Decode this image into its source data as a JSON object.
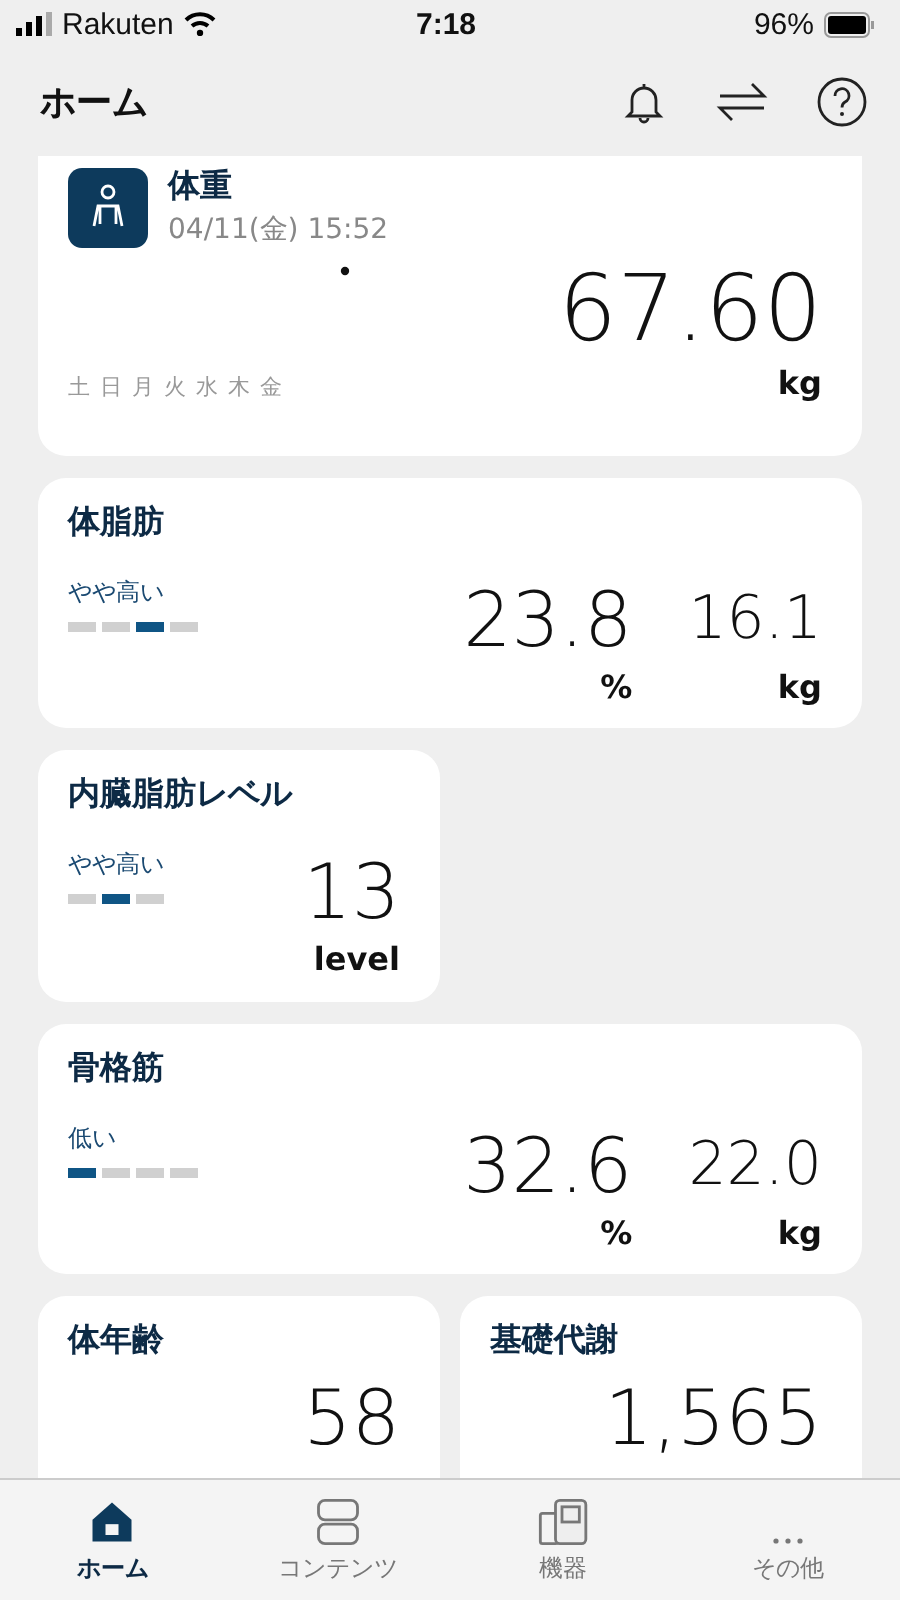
{
  "status_bar": {
    "carrier": "Rakuten",
    "time": "7:18",
    "battery": "96%"
  },
  "header": {
    "title": "ホーム"
  },
  "weight_card": {
    "title": "体重",
    "date": "04/11(金) 15:52",
    "value": "67.60",
    "unit": "kg",
    "days": [
      "土",
      "日",
      "月",
      "火",
      "水",
      "木",
      "金"
    ]
  },
  "metric_cards": [
    {
      "kind": "wide",
      "title": "体脂肪",
      "status": "やや高い",
      "segments": [
        {
          "selected": false
        },
        {
          "selected": false
        },
        {
          "selected": true
        },
        {
          "selected": false
        }
      ],
      "readings": [
        {
          "value": "23.8",
          "unit": "%"
        },
        {
          "value": "16.1",
          "unit": "kg"
        }
      ]
    },
    {
      "kind": "half",
      "title": "内臓脂肪レベル",
      "status": "やや高い",
      "segments": [
        {
          "selected": false
        },
        {
          "selected": true
        },
        {
          "selected": false
        }
      ],
      "readings": [
        {
          "value": "13",
          "unit": "level"
        }
      ]
    },
    {
      "kind": "wide",
      "title": "骨格筋",
      "status": "低い",
      "segments": [
        {
          "selected": true
        },
        {
          "selected": false
        },
        {
          "selected": false
        },
        {
          "selected": false
        }
      ],
      "readings": [
        {
          "value": "32.6",
          "unit": "%"
        },
        {
          "value": "22.0",
          "unit": "kg"
        }
      ]
    },
    {
      "kind": "half",
      "title": "体年齢",
      "readings": [
        {
          "value": "58"
        }
      ]
    },
    {
      "kind": "half",
      "title": "基礎代謝",
      "readings": [
        {
          "value": "1,565"
        }
      ]
    }
  ],
  "tab_bar": [
    {
      "kind": "home",
      "label": "ホーム",
      "selected": true
    },
    {
      "kind": "contents",
      "label": "コンテンツ",
      "selected": false
    },
    {
      "kind": "devices",
      "label": "機器",
      "selected": false
    },
    {
      "kind": "more",
      "label": "その他",
      "selected": false
    }
  ]
}
